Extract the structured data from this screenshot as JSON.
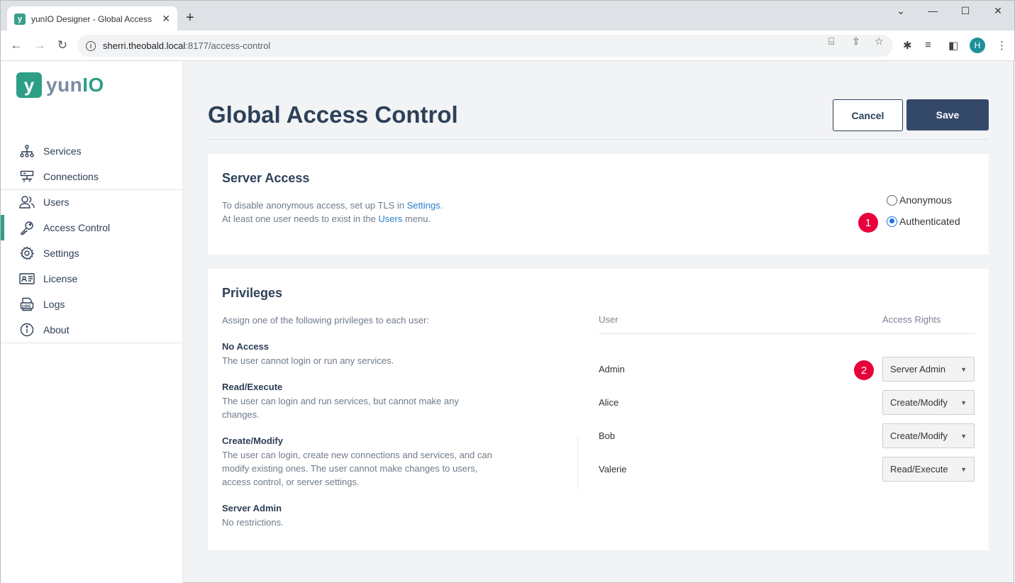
{
  "browser": {
    "tab_title": "yunIO Designer - Global Access",
    "favicon_letter": "y",
    "url_host": "sherri.theobald.local",
    "url_rest": ":8177/access-control",
    "profile_initial": "H"
  },
  "app": {
    "logo_mark": "y",
    "logo_text_a": "yun",
    "logo_text_b": "IO",
    "accent": "#2e9f86"
  },
  "sidebar": {
    "items": [
      {
        "label": "Services",
        "icon": "sitemap-icon"
      },
      {
        "label": "Connections",
        "icon": "connections-icon"
      },
      {
        "label": "Users",
        "icon": "users-icon"
      },
      {
        "label": "Access Control",
        "icon": "key-icon",
        "active": true
      },
      {
        "label": "Settings",
        "icon": "gear-icon"
      },
      {
        "label": "License",
        "icon": "id-card-icon"
      },
      {
        "label": "Logs",
        "icon": "logs-icon"
      },
      {
        "label": "About",
        "icon": "info-icon"
      }
    ]
  },
  "page": {
    "title": "Global Access Control",
    "cancel_label": "Cancel",
    "save_label": "Save"
  },
  "server_access": {
    "title": "Server Access",
    "desc_line1_a": "To disable anonymous access, set up TLS in ",
    "desc_line1_link": "Settings",
    "desc_line1_b": ".",
    "desc_line2_a": "At least one user needs to exist in the ",
    "desc_line2_link": "Users",
    "desc_line2_b": " menu.",
    "options": [
      "Anonymous",
      "Authenticated"
    ],
    "selected": "Authenticated",
    "badge": "1"
  },
  "privileges": {
    "title": "Privileges",
    "intro": "Assign one of the following privileges to each user:",
    "levels": [
      {
        "name": "No Access",
        "desc": "The user cannot login or run any services."
      },
      {
        "name": "Read/Execute",
        "desc": "The user can login and run services, but cannot make any changes."
      },
      {
        "name": "Create/Modify",
        "desc": "The user can login, create new connections and services, and can modify existing ones. The user cannot make changes to users, access control, or server settings."
      },
      {
        "name": "Server Admin",
        "desc": "No restrictions."
      }
    ],
    "col_user": "User",
    "col_rights": "Access Rights",
    "badge": "2",
    "users": [
      {
        "name": "Admin",
        "rights": "Server Admin"
      },
      {
        "name": "Alice",
        "rights": "Create/Modify"
      },
      {
        "name": "Bob",
        "rights": "Create/Modify"
      },
      {
        "name": "Valerie",
        "rights": "Read/Execute"
      }
    ]
  }
}
